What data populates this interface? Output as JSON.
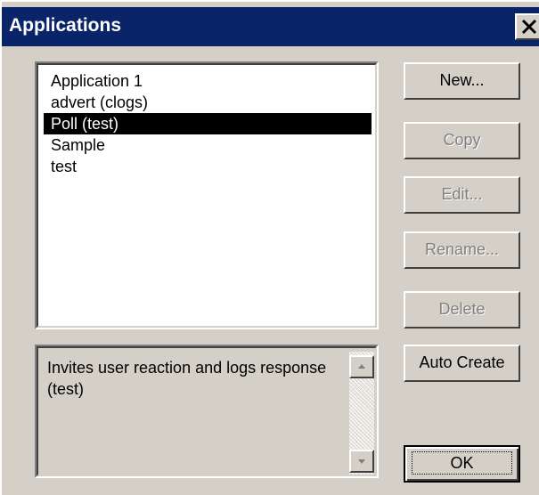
{
  "window": {
    "title": "Applications"
  },
  "applications": {
    "items": [
      {
        "label": "Application 1",
        "selected": false
      },
      {
        "label": "advert (clogs)",
        "selected": false
      },
      {
        "label": "Poll (test)",
        "selected": true
      },
      {
        "label": "Sample",
        "selected": false
      },
      {
        "label": "test",
        "selected": false
      }
    ]
  },
  "description": {
    "text": "Invites user reaction and logs response (test)"
  },
  "buttons": {
    "new": {
      "label": "New...",
      "enabled": true
    },
    "copy": {
      "label": "Copy",
      "enabled": false
    },
    "edit": {
      "label": "Edit...",
      "enabled": false
    },
    "rename": {
      "label": "Rename...",
      "enabled": false
    },
    "delete": {
      "label": "Delete",
      "enabled": false
    },
    "auto_create": {
      "label": "Auto Create",
      "enabled": true
    },
    "ok": {
      "label": "OK",
      "enabled": true
    }
  },
  "colors": {
    "titlebar": "#0a246a",
    "face": "#d4d0c8",
    "selection": "#000000"
  },
  "icons": {
    "close": "close-icon",
    "scroll_up": "arrow-up-icon",
    "scroll_down": "arrow-down-icon"
  }
}
